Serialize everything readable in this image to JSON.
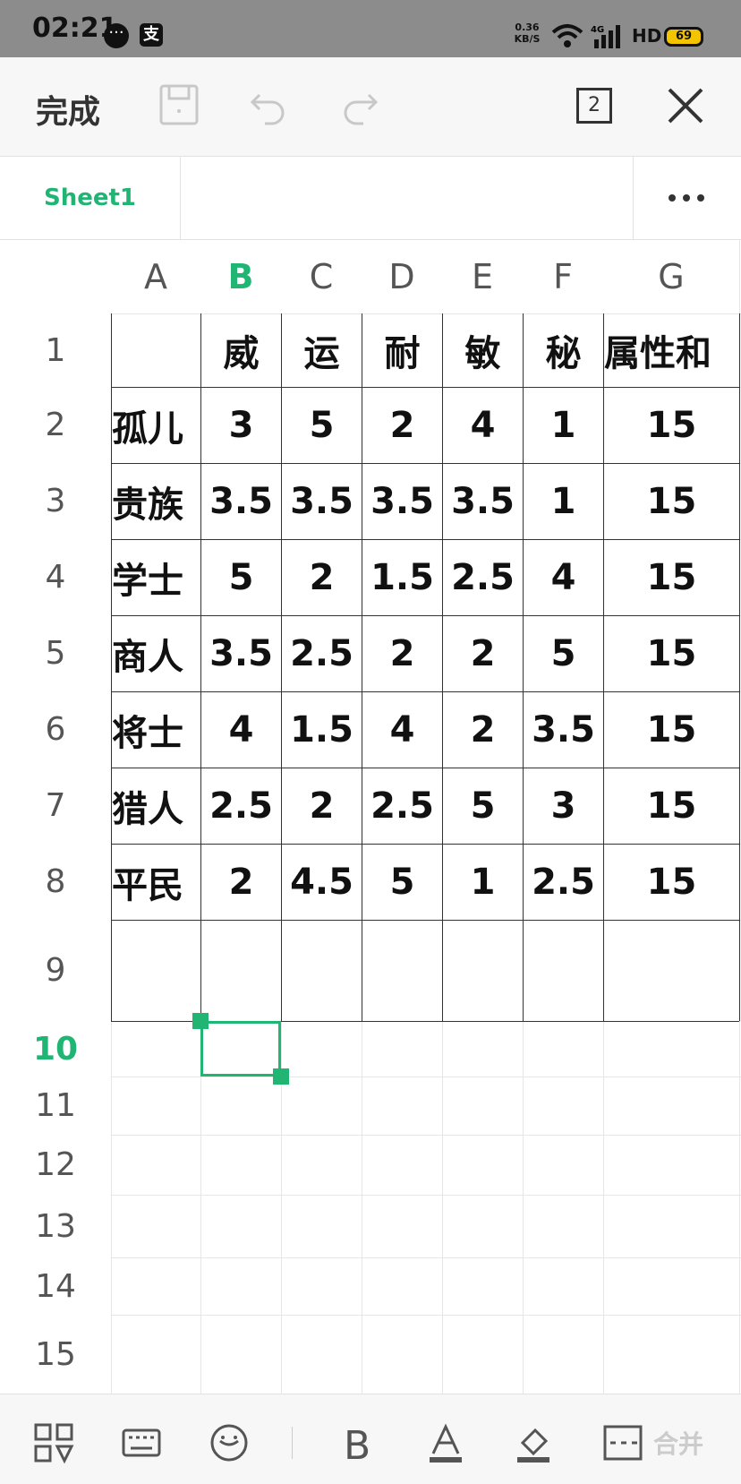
{
  "status_bar": {
    "time": "02:21",
    "net_speed_value": "0.36",
    "net_speed_unit": "KB/S",
    "network": "4G",
    "hd": "HD",
    "battery": "69"
  },
  "toolbar": {
    "done_label": "完成",
    "page_count": "2"
  },
  "sheet_tabs": {
    "active": "Sheet1"
  },
  "columns": [
    "A",
    "B",
    "C",
    "D",
    "E",
    "F",
    "G"
  ],
  "active_column": "B",
  "rows": [
    "1",
    "2",
    "3",
    "4",
    "5",
    "6",
    "7",
    "8",
    "9",
    "10",
    "11",
    "12",
    "13",
    "14",
    "15"
  ],
  "active_row": "10",
  "header_row": [
    "",
    "威",
    "运",
    "耐",
    "敏",
    "秘",
    "属性和"
  ],
  "table": [
    [
      "孤儿",
      "3",
      "5",
      "2",
      "4",
      "1",
      "15"
    ],
    [
      "贵族",
      "3.5",
      "3.5",
      "3.5",
      "3.5",
      "1",
      "15"
    ],
    [
      "学士",
      "5",
      "2",
      "1.5",
      "2.5",
      "4",
      "15"
    ],
    [
      "商人",
      "3.5",
      "2.5",
      "2",
      "2",
      "5",
      "15"
    ],
    [
      "将士",
      "4",
      "1.5",
      "4",
      "2",
      "3.5",
      "15"
    ],
    [
      "猎人",
      "2.5",
      "2",
      "2.5",
      "5",
      "3",
      "15"
    ],
    [
      "平民",
      "2",
      "4.5",
      "5",
      "1",
      "2.5",
      "15"
    ]
  ],
  "bottom_toolbar": {
    "merge_label": "合并"
  },
  "colors": {
    "accent": "#21b573",
    "grid_line": "#e6e6e6",
    "border_line": "#333333"
  }
}
